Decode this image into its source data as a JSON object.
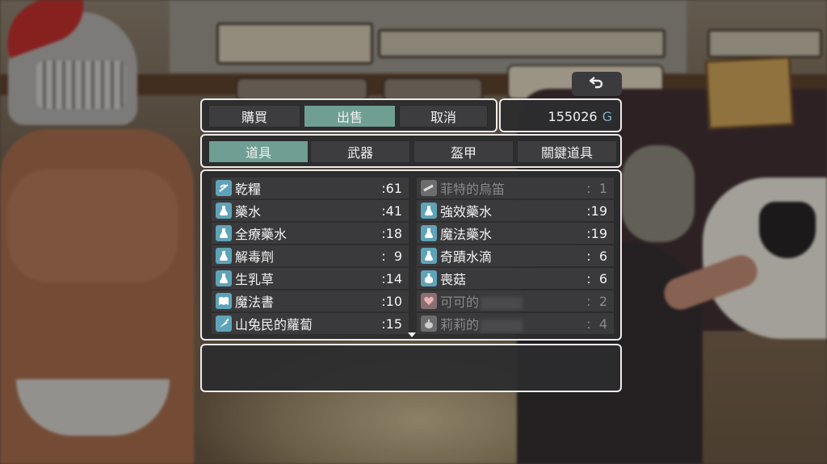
{
  "colors": {
    "accent_active": "#6f9f93",
    "gold_unit": "#7fb3c4",
    "item_icon": "#5fa3b9"
  },
  "header": {
    "mode_tabs": [
      {
        "label": "購買",
        "active": false
      },
      {
        "label": "出售",
        "active": true
      },
      {
        "label": "取消",
        "active": false
      }
    ],
    "gold": {
      "amount": "155026",
      "unit": "G"
    },
    "back_icon": "return-arrow-icon"
  },
  "categories": [
    {
      "label": "道具",
      "active": true
    },
    {
      "label": "武器",
      "active": false
    },
    {
      "label": "盔甲",
      "active": false
    },
    {
      "label": "關鍵道具",
      "active": false
    }
  ],
  "items_left": [
    {
      "name": "乾糧",
      "qty": ":61",
      "icon": "bread-icon"
    },
    {
      "name": "藥水",
      "qty": ":41",
      "icon": "potion-icon"
    },
    {
      "name": "全療藥水",
      "qty": ":18",
      "icon": "potion-icon"
    },
    {
      "name": "解毒劑",
      "qty": ":  9",
      "icon": "potion-icon"
    },
    {
      "name": "生乳草",
      "qty": ":14",
      "icon": "potion-icon"
    },
    {
      "name": "魔法書",
      "qty": ":10",
      "icon": "book-icon"
    },
    {
      "name": "山兔民的蘿蔔",
      "qty": ":15",
      "icon": "carrot-icon"
    }
  ],
  "items_right": [
    {
      "name": "菲特的烏笛",
      "qty": ":  1",
      "icon": "flute-icon",
      "disabled": true
    },
    {
      "name": "強效藥水",
      "qty": ":19",
      "icon": "potion-icon"
    },
    {
      "name": "魔法藥水",
      "qty": ":19",
      "icon": "potion-icon"
    },
    {
      "name": "奇蹟水滴",
      "qty": ":  6",
      "icon": "potion-icon"
    },
    {
      "name": "喪菇",
      "qty": ":  6",
      "icon": "bag-icon"
    },
    {
      "name": "可可的",
      "qty": ":  2",
      "icon": "heart-icon",
      "disabled": true,
      "censored": true
    },
    {
      "name": "莉莉的",
      "qty": ":  4",
      "icon": "teapot-icon",
      "disabled": true,
      "censored": true
    }
  ],
  "description": ""
}
